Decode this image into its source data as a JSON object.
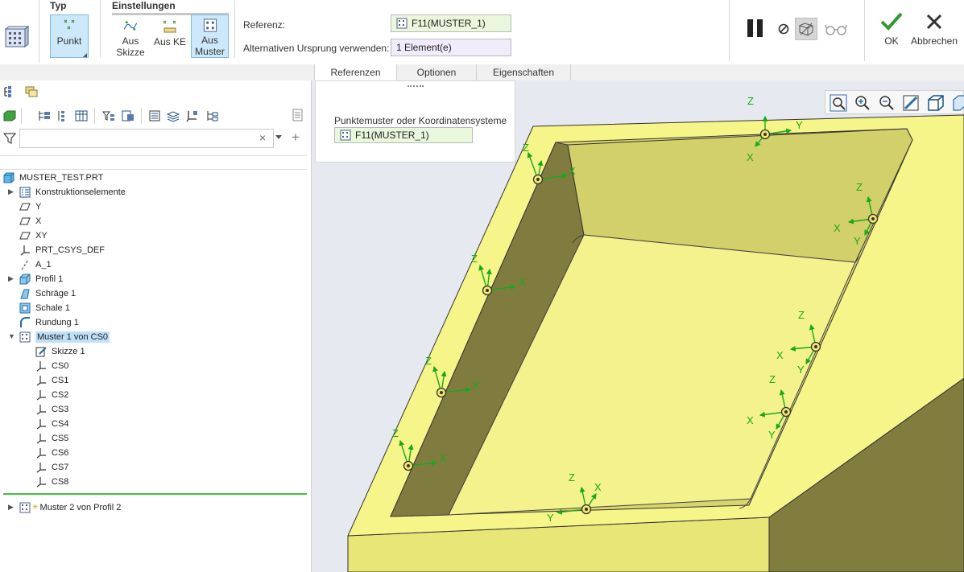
{
  "ribbon": {
    "group_typ": "Typ",
    "group_einstellungen": "Einstellungen",
    "btn_punkt": "Punkt",
    "btn_aus_skizze": "Aus\nSkizze",
    "btn_aus_ke": "Aus KE",
    "btn_aus_muster": "Aus\nMuster",
    "referenz_label": "Referenz:",
    "referenz_value": "F11(MUSTER_1)",
    "alt_label": "Alternativen Ursprung verwenden:",
    "alt_value": "1 Element(e)",
    "ok_label": "OK",
    "cancel_label": "Abbrechen"
  },
  "tabs": [
    "Referenzen",
    "Optionen",
    "Eigenschaften"
  ],
  "refpanel": {
    "title": "Punktemuster oder Koordinatensysteme",
    "value": "F11(MUSTER_1)"
  },
  "tree": {
    "root": "MUSTER_TEST.PRT",
    "items": [
      {
        "label": "Konstruktionselemente",
        "icon": "features-icon"
      },
      {
        "label": "Y",
        "icon": "datum-plane-icon"
      },
      {
        "label": "X",
        "icon": "datum-plane-icon"
      },
      {
        "label": "XY",
        "icon": "datum-plane-icon"
      },
      {
        "label": "PRT_CSYS_DEF",
        "icon": "csys-icon"
      },
      {
        "label": "A_1",
        "icon": "axis-icon"
      },
      {
        "label": "Profil 1",
        "icon": "extrude-icon"
      },
      {
        "label": "Schräge 1",
        "icon": "draft-icon"
      },
      {
        "label": "Schale 1",
        "icon": "shell-icon"
      },
      {
        "label": "Rundung 1",
        "icon": "round-icon"
      },
      {
        "label": "Muster 1 von CS0",
        "icon": "pattern-icon"
      }
    ],
    "children": [
      {
        "label": "Skizze 1",
        "icon": "sketch-icon"
      },
      {
        "label": "CS0",
        "icon": "csys-icon"
      },
      {
        "label": "CS1",
        "icon": "csys-icon"
      },
      {
        "label": "CS2",
        "icon": "csys-icon"
      },
      {
        "label": "CS3",
        "icon": "csys-icon"
      },
      {
        "label": "CS4",
        "icon": "csys-icon"
      },
      {
        "label": "CS5",
        "icon": "csys-icon"
      },
      {
        "label": "CS6",
        "icon": "csys-icon"
      },
      {
        "label": "CS7",
        "icon": "csys-icon"
      },
      {
        "label": "CS8",
        "icon": "csys-icon"
      }
    ],
    "last": {
      "label": "Muster 2 von Profil 2",
      "icon": "pattern-icon"
    }
  },
  "axis_labels": {
    "x": "X",
    "y": "Y",
    "z": "Z"
  },
  "colors": {
    "accent": "#7ab9e6",
    "selection": "#bfe0f7",
    "part_top": "#f6f58a",
    "part_inner": "#d5d36b",
    "part_wall": "#807c40",
    "csys_green": "#1aa81a"
  }
}
